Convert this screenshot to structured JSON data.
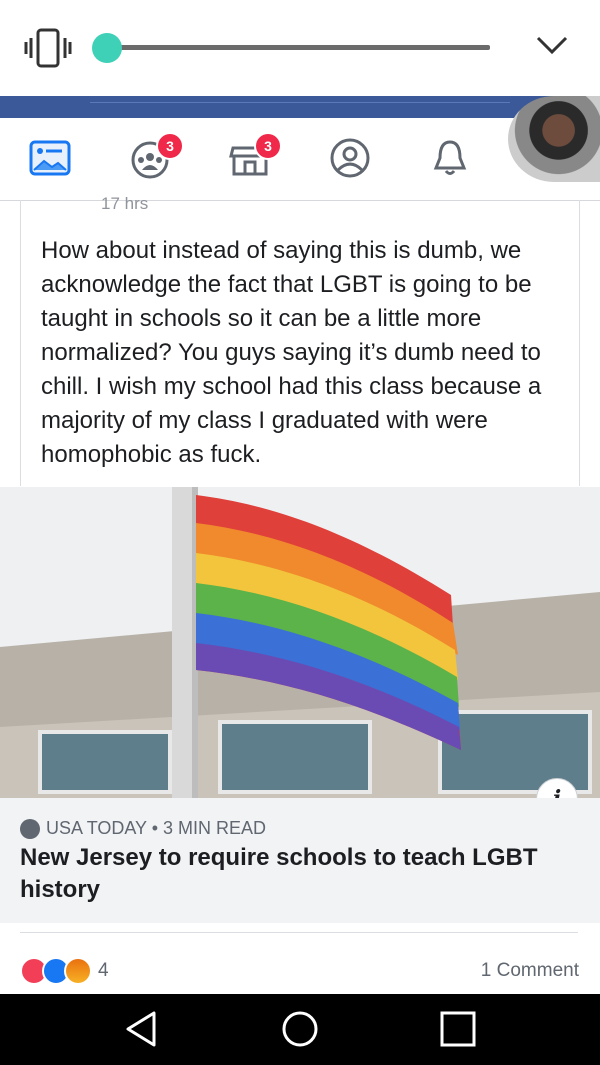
{
  "icons": {
    "vibrate": "vibrate-icon",
    "chevron": "chevron-down-icon",
    "news_feed": "news-feed-icon",
    "groups": "groups-icon",
    "marketplace": "marketplace-icon",
    "profile": "profile-icon",
    "notifications": "bell-icon"
  },
  "volume": {
    "level": 0.0
  },
  "nav": {
    "groups_badge": "3",
    "marketplace_badge": "3"
  },
  "post": {
    "time_fragment": "17 hrs",
    "body": "How about instead of saying this is dumb, we acknowledge the fact that LGBT is going to be taught in schools so it can be a little more normalized? You guys saying it’s dumb need to chill. I wish my school had this class because a majority of my class I graduated with were homophobic as fuck."
  },
  "link": {
    "source": "USA TODAY • 3 MIN READ",
    "headline": "New Jersey to require schools to teach LGBT history",
    "info_label": "i"
  },
  "engagement": {
    "reaction_count": "4",
    "comments": "1 Comment"
  },
  "colors": {
    "brand_blue": "#3b5998",
    "badge_red": "#f02849",
    "slider_teal": "#3fd1b7"
  }
}
